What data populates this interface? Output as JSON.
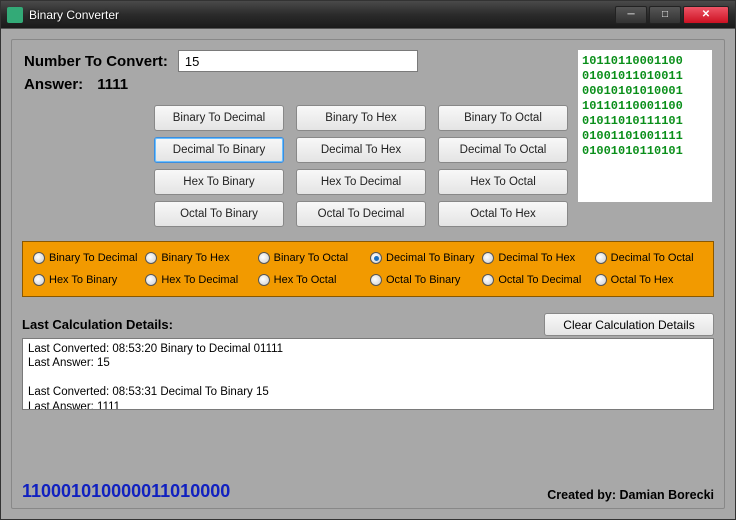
{
  "window": {
    "title": "Binary Converter"
  },
  "inputs": {
    "convert_label": "Number To Convert:",
    "convert_value": "15",
    "answer_label": "Answer:",
    "answer_value": "1111"
  },
  "buttons": {
    "b2d": "Binary To Decimal",
    "b2h": "Binary To Hex",
    "b2o": "Binary To Octal",
    "d2b": "Decimal To Binary",
    "d2h": "Decimal To Hex",
    "d2o": "Decimal To Octal",
    "h2b": "Hex To Binary",
    "h2d": "Hex To Decimal",
    "h2o": "Hex To Octal",
    "o2b": "Octal To Binary",
    "o2d": "Octal To Decimal",
    "o2h": "Octal To Hex",
    "selected": "d2b"
  },
  "radios": {
    "b2d": "Binary To Decimal",
    "b2h": "Binary To Hex",
    "b2o": "Binary To Octal",
    "d2b": "Decimal To Binary",
    "d2h": "Decimal To Hex",
    "d2o": "Decimal To Octal",
    "h2b": "Hex To Binary",
    "h2d": "Hex To Decimal",
    "h2o": "Hex To Octal",
    "o2b": "Octal To Binary",
    "o2d": "Octal To Decimal",
    "o2h": "Octal To Hex",
    "checked": "d2b"
  },
  "art": {
    "l0": "10110110001100",
    "l1": "01001011010011",
    "l2": "00010101010001",
    "l3": "10110110001100",
    "l4": "01011010111101",
    "l5": "01001101001111",
    "l6": "01001010110101"
  },
  "details": {
    "heading": "Last Calculation Details:",
    "clear": "Clear Calculation Details",
    "log": "Last Converted: 08:53:20  Binary to Decimal 01111\nLast Answer: 15\n\nLast Converted: 08:53:31  Decimal To Binary 15\nLast Answer: 1111"
  },
  "footer": {
    "binary": "110001010000011010000",
    "credit": "Created by: Damian Borecki"
  }
}
